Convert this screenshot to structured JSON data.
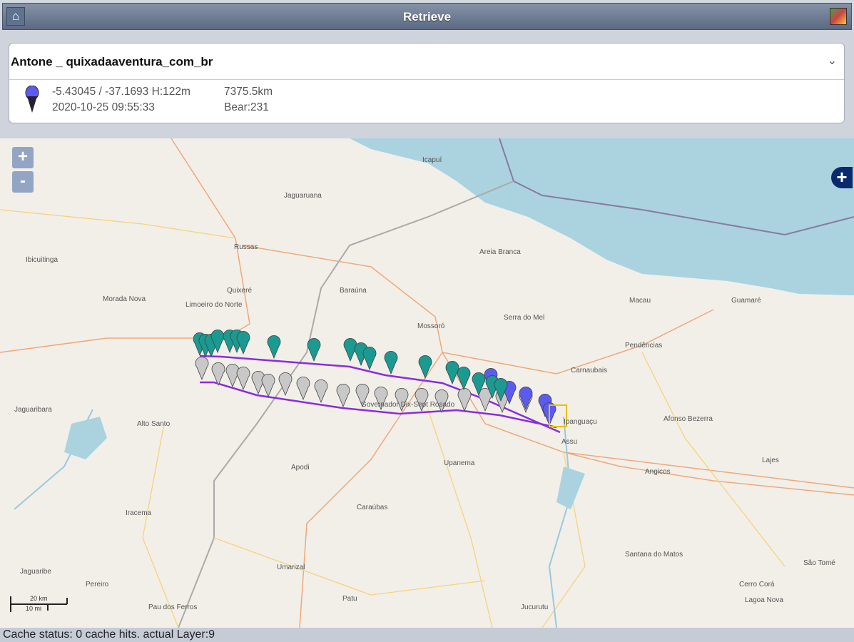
{
  "header": {
    "title": "Retrieve",
    "home_icon": "home-icon",
    "layers_icon": "layers-icon"
  },
  "tracker": {
    "selected": "Antone _ quixadaaventura_com_br",
    "coords": "-5.43045 / -37.1693 H:122m",
    "distance": "7375.5km",
    "datetime": "2020-10-25 09:55:33",
    "bearing": "Bear:231",
    "pin_color": "#5b5bf0"
  },
  "map": {
    "zoom_in": "+",
    "zoom_out": "-",
    "layer_switcher": "+",
    "towns": [
      "Icapuí",
      "Jaguaruana",
      "Russas",
      "Ibicuitinga",
      "Morada Nova",
      "Quixeré",
      "Limoeiro do Norte",
      "Baraúna",
      "Areia Branca",
      "Mossoró",
      "Serra do Mel",
      "Macau",
      "Guamaré",
      "Pendências",
      "Carnaubais",
      "Afonso Bezerra",
      "Ipanguaçu",
      "Assu",
      "Jaguaribara",
      "Alto Santo",
      "Apodi",
      "Upanema",
      "Angicos",
      "Lajes",
      "Iracema",
      "Caraúbas",
      "Jaguaribe",
      "Umarizal",
      "Santana do Matos",
      "São Tomé",
      "Pereiro",
      "Pau dos Ferros",
      "Patu",
      "Jucurutu",
      "Cerro Corá",
      "Lagoa Nova",
      "Governador Dix-Sept Rosado"
    ],
    "scale_km": "20 km",
    "scale_mi": "10 mi",
    "colors": {
      "sea": "#aad3df",
      "land": "#f2efe9",
      "track": "#8a2be2",
      "marker_teal": "#1a9a90",
      "marker_gray": "#c8c8c8",
      "marker_blue": "#5b5bf0"
    }
  },
  "status": "Cache status: 0 cache hits. actual Layer:9"
}
